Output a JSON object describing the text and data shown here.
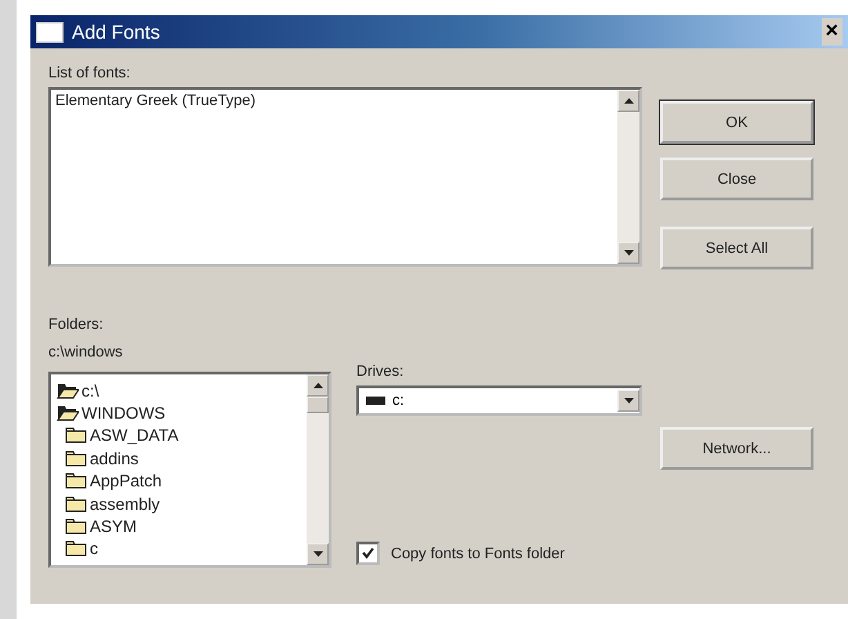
{
  "window": {
    "title": "Add Fonts",
    "close": "×"
  },
  "fonts": {
    "label": "List of fonts:",
    "items": [
      "Elementary Greek (TrueType)"
    ]
  },
  "buttons": [
    {
      "label": "OK",
      "default": true
    },
    {
      "label": "Close",
      "default": false
    },
    {
      "label": "Select All",
      "default": false
    }
  ],
  "folders": {
    "label": "Folders:",
    "path": "c:\\windows",
    "tree": [
      {
        "name": "c:\\",
        "expanded": true,
        "children": [
          {
            "name": "WINDOWS",
            "expanded": true,
            "children": [
              {
                "name": "ASW_DATA",
                "expanded": false
              },
              {
                "name": "addins",
                "expanded": false
              },
              {
                "name": "AppPatch",
                "expanded": false
              },
              {
                "name": "assembly",
                "expanded": false
              },
              {
                "name": "ASYM",
                "expanded": false
              },
              {
                "name": "c",
                "expanded": false
              }
            ]
          }
        ]
      }
    ]
  },
  "drives": {
    "label": "Drives:",
    "value": "c:"
  },
  "network_button": "Network...",
  "copy_checkbox": {
    "label": "Copy fonts to Fonts folder",
    "checked": true
  }
}
